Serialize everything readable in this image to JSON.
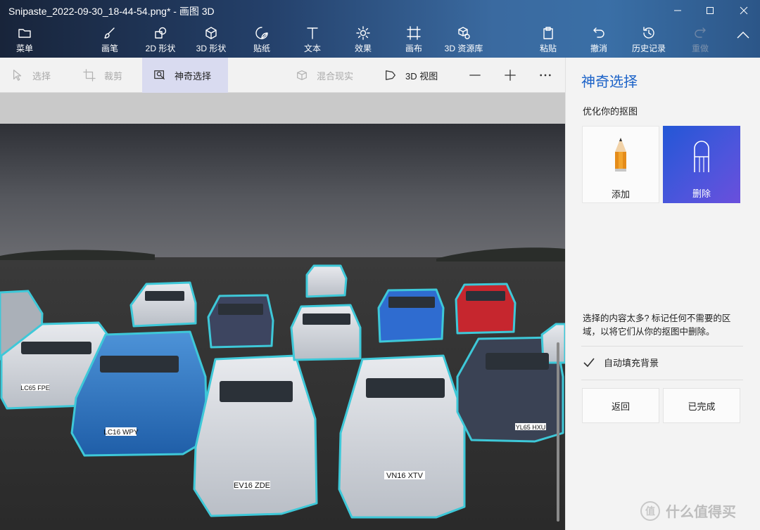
{
  "window": {
    "title": "Snipaste_2022-09-30_18-44-54.png* - 画图 3D"
  },
  "ribbon": {
    "menu": "菜单",
    "brushes": "画笔",
    "shapes_2d": "2D 形状",
    "shapes_3d": "3D 形状",
    "stickers": "贴纸",
    "text": "文本",
    "effects": "效果",
    "canvas": "画布",
    "library_3d": "3D 资源库",
    "paste": "粘贴",
    "undo": "撤消",
    "history": "历史记录",
    "redo": "重做"
  },
  "toolbar": {
    "select": "选择",
    "crop": "裁剪",
    "magic_select": "神奇选择",
    "mixed_reality": "混合现实",
    "view_3d": "3D 视图"
  },
  "panel": {
    "title": "神奇选择",
    "subtitle": "优化你的抠图",
    "add_label": "添加",
    "remove_label": "删除",
    "hint": "选择的内容太多? 标记任何不需要的区域，以将它们从你的抠图中删除。",
    "autofill_label": "自动填充背景",
    "autofill_checked": true,
    "back_label": "返回",
    "done_label": "已完成"
  },
  "plates": [
    "LC65 FPE",
    "LC16 WPY",
    "EV16 ZDE",
    "VN16 XTV",
    "YL65 HXU"
  ],
  "watermark": {
    "icon_text": "值",
    "text": "什么值得买"
  }
}
